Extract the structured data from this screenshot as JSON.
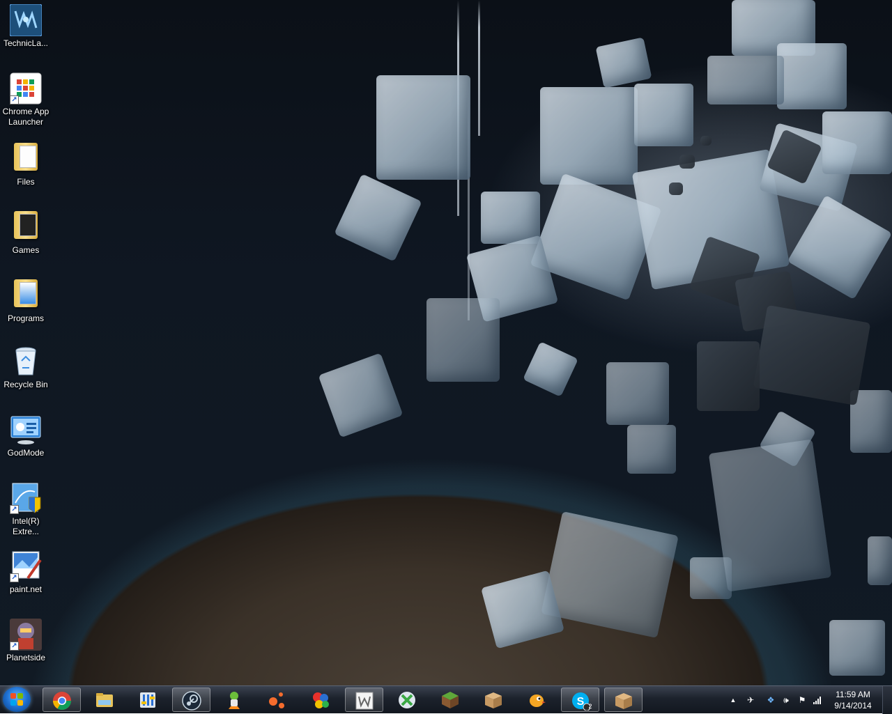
{
  "desktop": {
    "icons": [
      {
        "label": "TechnicLa..."
      },
      {
        "label": "Chrome App Launcher"
      },
      {
        "label": "Files"
      },
      {
        "label": "Games"
      },
      {
        "label": "Programs"
      },
      {
        "label": "Recycle Bin"
      },
      {
        "label": "GodMode"
      },
      {
        "label": "Intel(R) Extre..."
      },
      {
        "label": "paint.net"
      },
      {
        "label": "Planetside"
      }
    ]
  },
  "taskbar": {
    "start": {
      "icon": "windows-logo-icon"
    },
    "pinned": [
      {
        "name": "chrome",
        "icon": "chrome-icon"
      },
      {
        "name": "explorer",
        "icon": "folder-icon"
      },
      {
        "name": "control-panel",
        "icon": "control-panel-icon"
      },
      {
        "name": "steam",
        "icon": "steam-icon"
      },
      {
        "name": "kerbal",
        "icon": "kerbal-icon"
      },
      {
        "name": "origin",
        "icon": "origin-icon"
      },
      {
        "name": "paint",
        "icon": "color-balls-icon"
      },
      {
        "name": "wordpad",
        "icon": "w-letter-icon"
      },
      {
        "name": "xbox-game",
        "icon": "xbox-icon"
      },
      {
        "name": "minecraft",
        "icon": "grass-block-icon"
      },
      {
        "name": "box-app",
        "icon": "cardboard-box-icon"
      },
      {
        "name": "bird-game",
        "icon": "bird-icon"
      },
      {
        "name": "skype",
        "icon": "skype-icon",
        "badge": "2"
      },
      {
        "name": "box-app-2",
        "icon": "cardboard-box-icon"
      }
    ],
    "tray": {
      "time": "11:59 AM",
      "date": "9/14/2014"
    }
  },
  "colors": {
    "taskbar_top": "#3b4250",
    "taskbar_bottom": "#12171f",
    "start_blue": "#1d6fd1"
  }
}
